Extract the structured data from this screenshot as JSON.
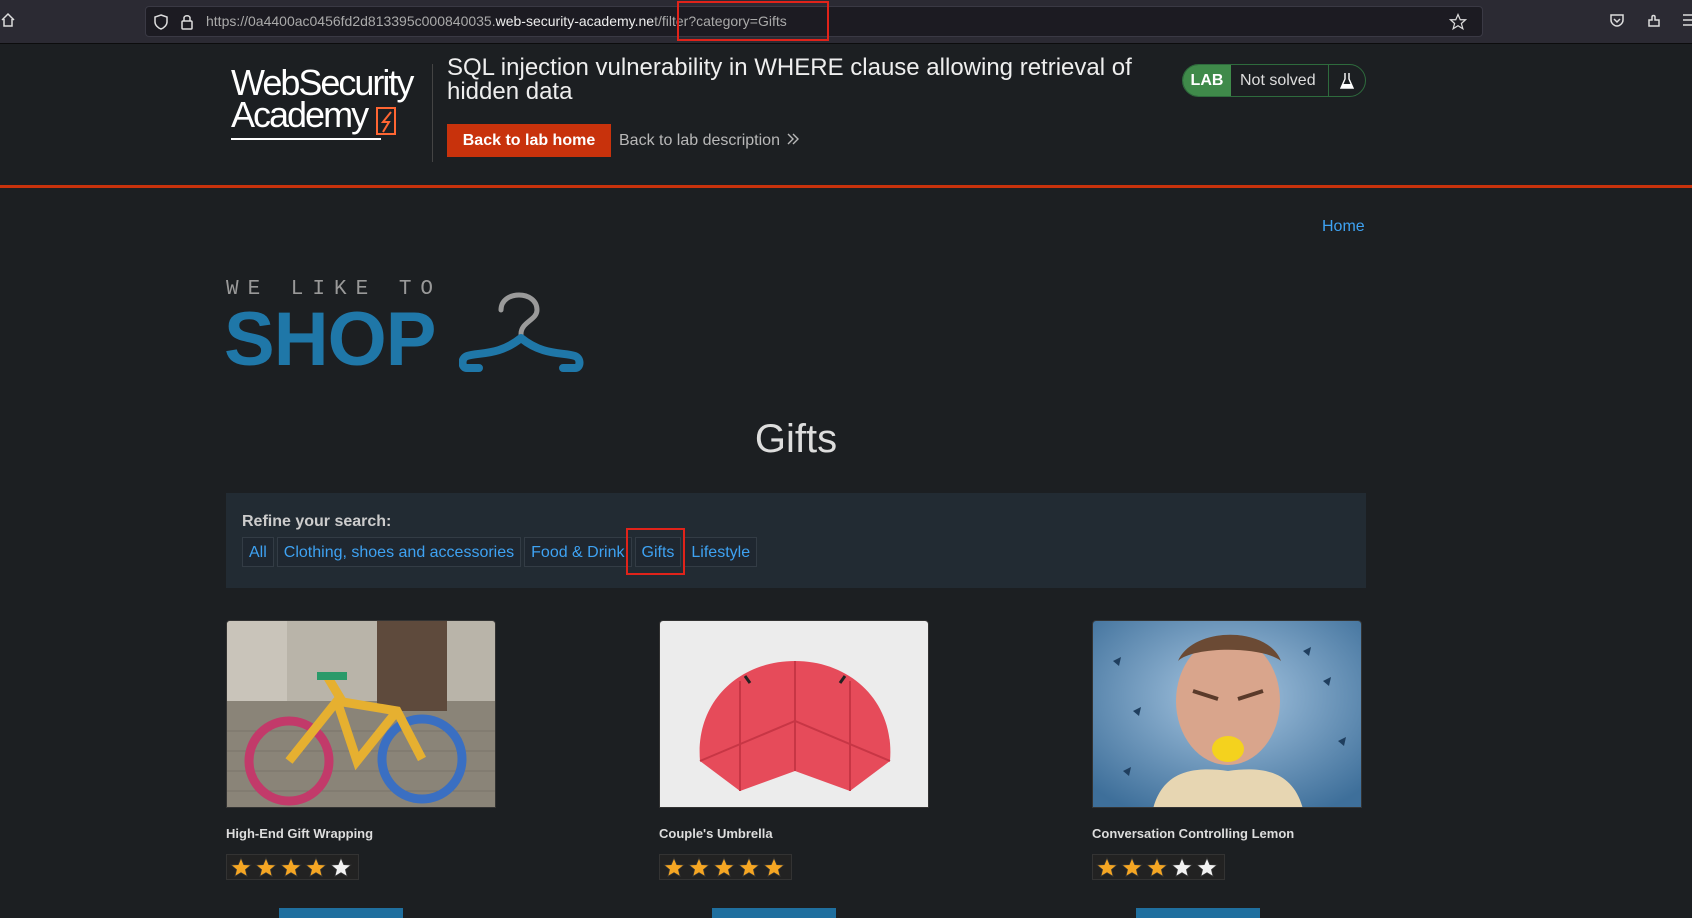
{
  "browser": {
    "url_prefix": "https://0a4400ac0456fd2d813395c000840035.",
    "url_domain": "web-security-academy.ne",
    "url_suffix": "t/filter?category=Gifts",
    "icons": [
      "home-icon",
      "shield-icon",
      "lock-icon",
      "bookmark-star-icon",
      "pocket-icon",
      "extensions-icon",
      "menu-icon"
    ]
  },
  "lab": {
    "logo_line1": "WebSecurity",
    "logo_line2": "Academy",
    "title": "SQL injection vulnerability in WHERE clause allowing retrieval of hidden data",
    "back_home": "Back to lab home",
    "back_description": "Back to lab description",
    "badge_label": "LAB",
    "status": "Not solved",
    "accent": "#c8320c"
  },
  "nav": {
    "home": "Home"
  },
  "shop_logo": {
    "line1": "WE LIKE TO",
    "line2": "SHOP"
  },
  "heading": "Gifts",
  "filter": {
    "label": "Refine your search:",
    "categories": [
      "All",
      "Clothing, shoes and accessories",
      "Food & Drink",
      "Gifts",
      "Lifestyle"
    ],
    "selected": "Gifts"
  },
  "products": [
    {
      "name": "High-End Gift Wrapping",
      "rating": 4
    },
    {
      "name": "Couple's Umbrella",
      "rating": 5
    },
    {
      "name": "Conversation Controlling Lemon",
      "rating": 3
    }
  ]
}
